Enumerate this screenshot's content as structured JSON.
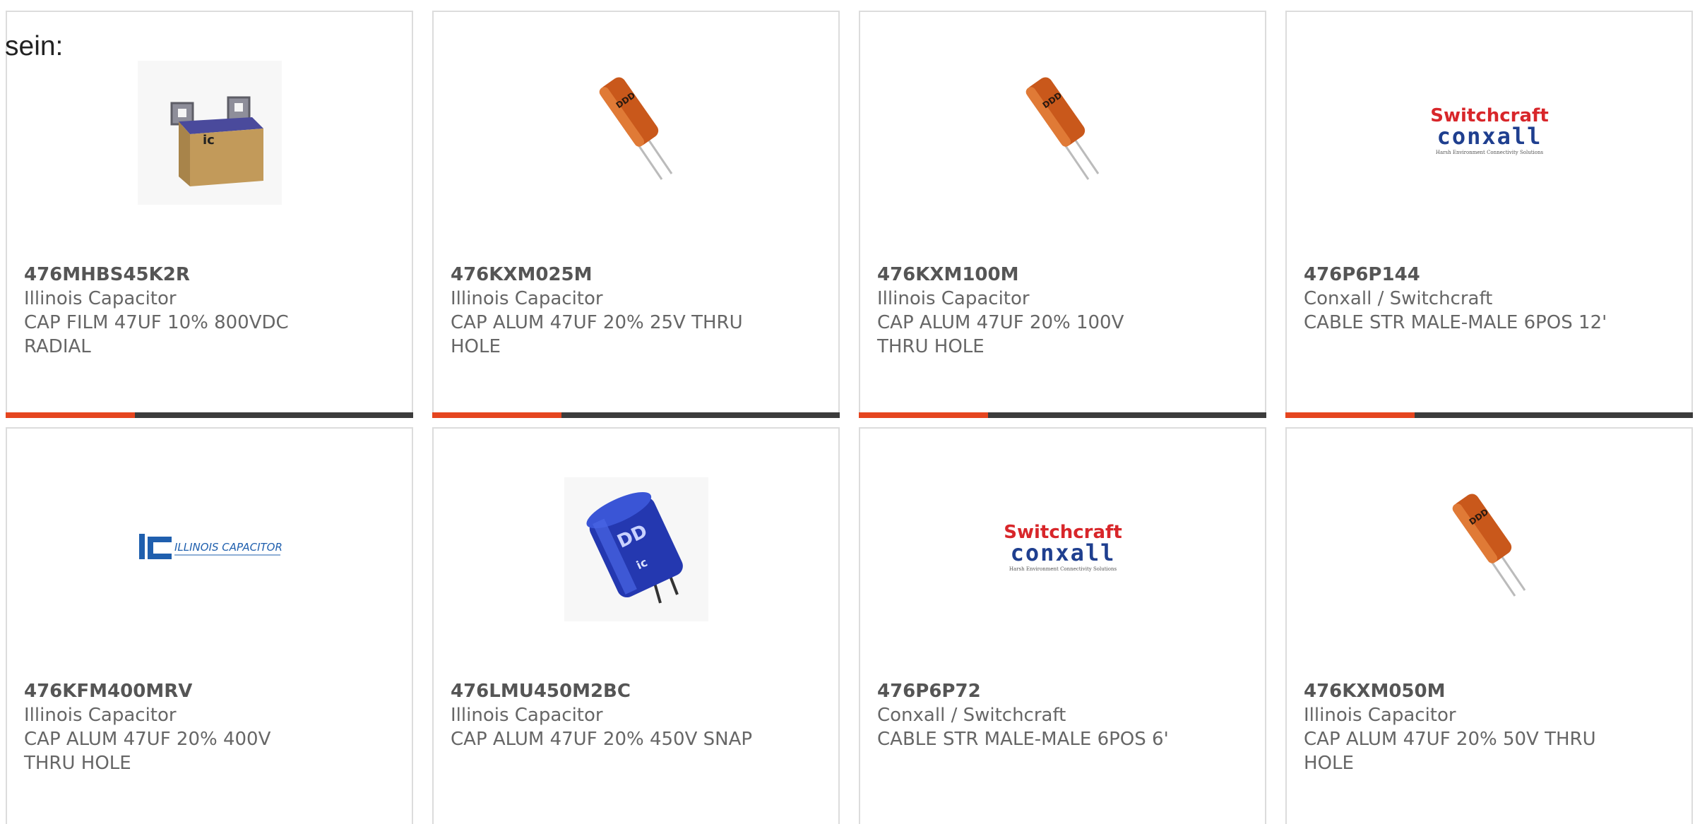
{
  "intro_text": "sein:",
  "colors": {
    "accent": "#e5451f",
    "bar_dark": "#3c3c3c",
    "text": "#666666",
    "border": "#dcdcdc"
  },
  "products": [
    {
      "part_number": "476MHBS45K2R",
      "manufacturer": "Illinois Capacitor",
      "description": "CAP FILM 47UF 10% 800VDC RADIAL",
      "image": "film-capacitor-image"
    },
    {
      "part_number": "476KXM025M",
      "manufacturer": "Illinois Capacitor",
      "description": "CAP ALUM 47UF 20% 25V THRU HOLE",
      "image": "radial-electrolytic-capacitor-image"
    },
    {
      "part_number": "476KXM100M",
      "manufacturer": "Illinois Capacitor",
      "description": "CAP ALUM 47UF 20% 100V THRU HOLE",
      "image": "radial-electrolytic-capacitor-image"
    },
    {
      "part_number": "476P6P144",
      "manufacturer": "Conxall / Switchcraft",
      "description": "CABLE STR MALE-MALE 6POS 12'",
      "image": "switchcraft-conxall-logo",
      "logo_line1": "Switchcraft",
      "logo_line2": "conxall",
      "logo_tagline": "Harsh Environment Connectivity Solutions"
    },
    {
      "part_number": "476KFM400MRV",
      "manufacturer": "Illinois Capacitor",
      "description": "CAP ALUM 47UF 20% 400V THRU HOLE",
      "image": "illinois-capacitor-logo",
      "logo_text": "ILLINOIS CAPACITOR, INC."
    },
    {
      "part_number": "476LMU450M2BC",
      "manufacturer": "Illinois Capacitor",
      "description": "CAP ALUM 47UF 20% 450V SNAP",
      "image": "snap-in-capacitor-image"
    },
    {
      "part_number": "476P6P72",
      "manufacturer": "Conxall / Switchcraft",
      "description": "CABLE STR MALE-MALE 6POS 6'",
      "image": "switchcraft-conxall-logo",
      "logo_line1": "Switchcraft",
      "logo_line2": "conxall",
      "logo_tagline": "Harsh Environment Connectivity Solutions"
    },
    {
      "part_number": "476KXM050M",
      "manufacturer": "Illinois Capacitor",
      "description": "CAP ALUM 47UF 20% 50V THRU HOLE",
      "image": "radial-electrolytic-capacitor-image"
    }
  ]
}
